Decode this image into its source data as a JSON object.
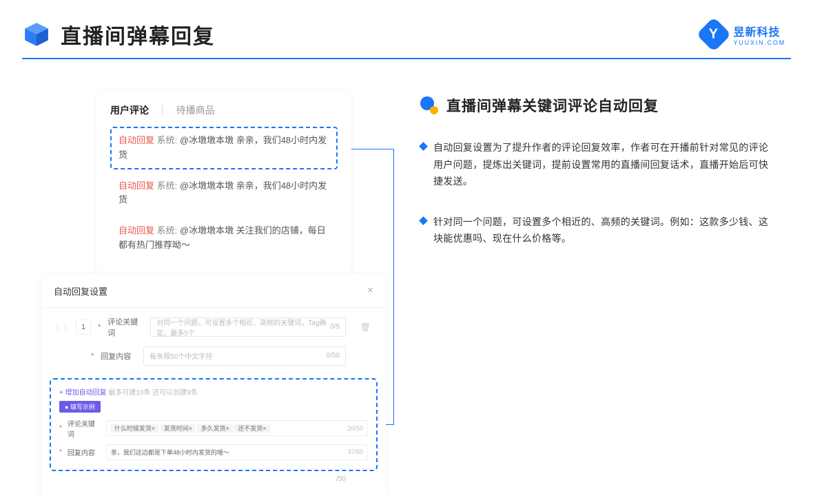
{
  "header": {
    "title": "直播间弹幕回复"
  },
  "brand": {
    "cn": "昱新科技",
    "en": "YUUXIN.COM",
    "letter": "Y"
  },
  "card1": {
    "tab_active": "用户评论",
    "tab_inactive": "待播商品",
    "tag": "自动回复",
    "sys": "系统:",
    "m1": "@冰墩墩本墩 亲亲，我们48小时内发货",
    "m2": "@冰墩墩本墩 亲亲，我们48小时内发货",
    "m3": "@冰墩墩本墩 关注我们的店铺，每日都有热门推荐呦～"
  },
  "card2": {
    "title": "自动回复设置",
    "close": "×",
    "num": "1",
    "lbl_kw": "评论关键词",
    "ph_kw": "对同一个问题，可设置多个相近、高频的关键词，Tag确定，最多5个",
    "cnt_kw": "0/5",
    "lbl_rp": "回复内容",
    "ph_rp": "每条限50个中文字符",
    "cnt_rp": "0/50",
    "add": "+ 增加自动回复",
    "add_hint": "最多可建10条 还可以创建9条",
    "badge": "● 填写示例",
    "ex_lbl_kw": "评论关键词",
    "ex_tags": [
      "什么时候发货×",
      "发货时间×",
      "多久发货×",
      "还不发货×"
    ],
    "ex_cnt_kw": "20/50",
    "ex_lbl_rp": "回复内容",
    "ex_rp_val": "亲，我们这边都是下单48小时内发货的哦～",
    "ex_cnt_rp": "37/50",
    "outer_cnt": "/50"
  },
  "right": {
    "title": "直播间弹幕关键词评论自动回复",
    "b1": "自动回复设置为了提升作者的评论回复效率，作者可在开播前针对常见的评论用户问题，提炼出关键词，提前设置常用的直播间回复话术，直播开始后可快捷发送。",
    "b2": "针对同一个问题，可设置多个相近的、高频的关键词。例如：这款多少钱、这块能优惠吗、现在什么价格等。"
  }
}
